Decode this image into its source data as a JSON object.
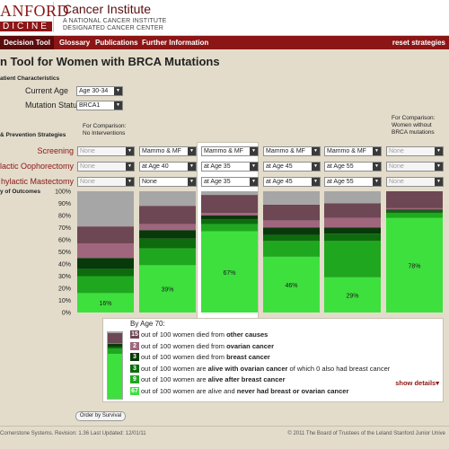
{
  "header": {
    "logo_top": "ANFORD",
    "logo_bottom": "DICINE",
    "institute": "Cancer Institute",
    "sub1": "A NATIONAL CANCER INSTITUTE",
    "sub2": "DESIGNATED CANCER CENTER"
  },
  "nav": {
    "items": [
      "Decision Tool",
      "Glossary",
      "Publications",
      "Further Information"
    ],
    "reset": "reset strategies"
  },
  "page_title": "n Tool for Women with BRCA Mutations",
  "patient": {
    "heading": "atient Characteristics",
    "age_label": "Current Age",
    "age_value": "Age 30-34",
    "mutation_label": "Mutation Status",
    "mutation_value": "BRCA1"
  },
  "strategies": {
    "heading": "& Prevention Strategies",
    "comparison_left": [
      "For Comparison:",
      "No Interventions"
    ],
    "comparison_right": [
      "For Comparison:",
      "Women without",
      "BRCA mutations"
    ],
    "row_labels": [
      "Screening",
      "lactic Oophorectomy",
      "hylactic Mastectomy"
    ],
    "columns": [
      {
        "screening": "None",
        "oophorectomy": "None",
        "mastectomy": "None",
        "disabled": true
      },
      {
        "screening": "Mammo & MF",
        "oophorectomy": "at Age 40",
        "mastectomy": "None",
        "disabled": false
      },
      {
        "screening": "Mammo & MF",
        "oophorectomy": "at Age 35",
        "mastectomy": "at Age 35",
        "disabled": false
      },
      {
        "screening": "Mammo & MF",
        "oophorectomy": "at Age 45",
        "mastectomy": "at Age 45",
        "disabled": false
      },
      {
        "screening": "Mammo & MF",
        "oophorectomy": "at Age 55",
        "mastectomy": "at Age 55",
        "disabled": false
      },
      {
        "screening": "None",
        "oophorectomy": "None",
        "mastectomy": "None",
        "disabled": true
      }
    ]
  },
  "outcomes_label": "y of Outcomes",
  "chart_data": {
    "type": "bar",
    "stacked": true,
    "ylim": [
      0,
      100
    ],
    "yticks": [
      "0%",
      "10%",
      "20%",
      "30%",
      "40%",
      "50%",
      "60%",
      "70%",
      "80%",
      "90%",
      "100%"
    ],
    "segment_colors": [
      "#3ee03e",
      "#1fa81f",
      "#0d6b0d",
      "#08390a",
      "#a0667e",
      "#6d4753",
      "#a6a6a6"
    ],
    "series_order": [
      "never had cancer",
      "alive after breast cancer",
      "alive with ovarian cancer",
      "died from breast cancer",
      "died from ovarian cancer",
      "died from other causes",
      "blank"
    ],
    "bars": [
      {
        "segments": [
          16,
          14,
          6,
          9,
          12,
          14,
          29
        ],
        "label": "16%"
      },
      {
        "segments": [
          39,
          14,
          8,
          7,
          5,
          15,
          12
        ],
        "label": "39%"
      },
      {
        "segments": [
          67,
          6,
          4,
          3,
          2,
          15,
          3
        ],
        "label": "67%"
      },
      {
        "segments": [
          46,
          13,
          5,
          6,
          6,
          13,
          11
        ],
        "label": "46%"
      },
      {
        "segments": [
          29,
          30,
          6,
          5,
          8,
          12,
          10
        ],
        "label": "29%"
      },
      {
        "segments": [
          78,
          4,
          2,
          1,
          1,
          14,
          0
        ],
        "label": "78%"
      }
    ]
  },
  "legend": {
    "title": "By Age 70:",
    "rows": [
      {
        "num": "15",
        "color": "#6d4753",
        "text": "out of 100 women died from ",
        "bold": "other causes",
        "after": ""
      },
      {
        "num": "2",
        "color": "#a0667e",
        "text": "out of 100 women died from ",
        "bold": "ovarian cancer",
        "after": ""
      },
      {
        "num": "3",
        "color": "#08390a",
        "text": "out of 100 women died from ",
        "bold": "breast cancer",
        "after": ""
      },
      {
        "num": "3",
        "color": "#0d6b0d",
        "text": "out of 100 women are ",
        "bold": "alive with ovarian cancer",
        "after": " of which 0 also had breast cancer"
      },
      {
        "num": "9",
        "color": "#1fa81f",
        "text": "out of 100 women are ",
        "bold": "alive after breast cancer",
        "after": ""
      },
      {
        "num": "67",
        "color": "#3ee03e",
        "text": "out of 100 women are alive and ",
        "bold": "never had breast or ovarian cancer",
        "after": ""
      }
    ],
    "show_details": "show details",
    "legend_segments": [
      67,
      9,
      3,
      3,
      2,
      15,
      1
    ]
  },
  "order_button": "Order by Survival",
  "footer": {
    "left": "Cornerstone Systems.  Revision: 1.36 Last Updated: 12/01/11",
    "right": "© 2011 The Board of Trustees of the Leland Stanford Junior Unive"
  }
}
